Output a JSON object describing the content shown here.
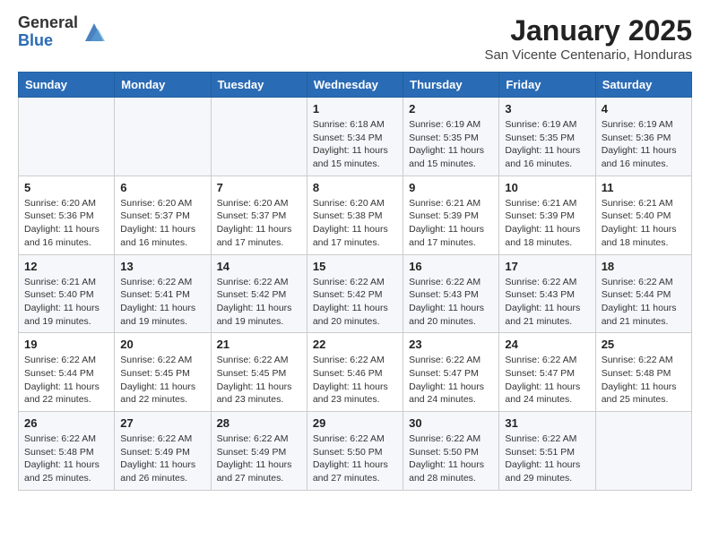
{
  "header": {
    "logo_general": "General",
    "logo_blue": "Blue",
    "month_title": "January 2025",
    "location": "San Vicente Centenario, Honduras"
  },
  "weekdays": [
    "Sunday",
    "Monday",
    "Tuesday",
    "Wednesday",
    "Thursday",
    "Friday",
    "Saturday"
  ],
  "weeks": [
    [
      {
        "day": "",
        "info": ""
      },
      {
        "day": "",
        "info": ""
      },
      {
        "day": "",
        "info": ""
      },
      {
        "day": "1",
        "info": "Sunrise: 6:18 AM\nSunset: 5:34 PM\nDaylight: 11 hours\nand 15 minutes."
      },
      {
        "day": "2",
        "info": "Sunrise: 6:19 AM\nSunset: 5:35 PM\nDaylight: 11 hours\nand 15 minutes."
      },
      {
        "day": "3",
        "info": "Sunrise: 6:19 AM\nSunset: 5:35 PM\nDaylight: 11 hours\nand 16 minutes."
      },
      {
        "day": "4",
        "info": "Sunrise: 6:19 AM\nSunset: 5:36 PM\nDaylight: 11 hours\nand 16 minutes."
      }
    ],
    [
      {
        "day": "5",
        "info": "Sunrise: 6:20 AM\nSunset: 5:36 PM\nDaylight: 11 hours\nand 16 minutes."
      },
      {
        "day": "6",
        "info": "Sunrise: 6:20 AM\nSunset: 5:37 PM\nDaylight: 11 hours\nand 16 minutes."
      },
      {
        "day": "7",
        "info": "Sunrise: 6:20 AM\nSunset: 5:37 PM\nDaylight: 11 hours\nand 17 minutes."
      },
      {
        "day": "8",
        "info": "Sunrise: 6:20 AM\nSunset: 5:38 PM\nDaylight: 11 hours\nand 17 minutes."
      },
      {
        "day": "9",
        "info": "Sunrise: 6:21 AM\nSunset: 5:39 PM\nDaylight: 11 hours\nand 17 minutes."
      },
      {
        "day": "10",
        "info": "Sunrise: 6:21 AM\nSunset: 5:39 PM\nDaylight: 11 hours\nand 18 minutes."
      },
      {
        "day": "11",
        "info": "Sunrise: 6:21 AM\nSunset: 5:40 PM\nDaylight: 11 hours\nand 18 minutes."
      }
    ],
    [
      {
        "day": "12",
        "info": "Sunrise: 6:21 AM\nSunset: 5:40 PM\nDaylight: 11 hours\nand 19 minutes."
      },
      {
        "day": "13",
        "info": "Sunrise: 6:22 AM\nSunset: 5:41 PM\nDaylight: 11 hours\nand 19 minutes."
      },
      {
        "day": "14",
        "info": "Sunrise: 6:22 AM\nSunset: 5:42 PM\nDaylight: 11 hours\nand 19 minutes."
      },
      {
        "day": "15",
        "info": "Sunrise: 6:22 AM\nSunset: 5:42 PM\nDaylight: 11 hours\nand 20 minutes."
      },
      {
        "day": "16",
        "info": "Sunrise: 6:22 AM\nSunset: 5:43 PM\nDaylight: 11 hours\nand 20 minutes."
      },
      {
        "day": "17",
        "info": "Sunrise: 6:22 AM\nSunset: 5:43 PM\nDaylight: 11 hours\nand 21 minutes."
      },
      {
        "day": "18",
        "info": "Sunrise: 6:22 AM\nSunset: 5:44 PM\nDaylight: 11 hours\nand 21 minutes."
      }
    ],
    [
      {
        "day": "19",
        "info": "Sunrise: 6:22 AM\nSunset: 5:44 PM\nDaylight: 11 hours\nand 22 minutes."
      },
      {
        "day": "20",
        "info": "Sunrise: 6:22 AM\nSunset: 5:45 PM\nDaylight: 11 hours\nand 22 minutes."
      },
      {
        "day": "21",
        "info": "Sunrise: 6:22 AM\nSunset: 5:45 PM\nDaylight: 11 hours\nand 23 minutes."
      },
      {
        "day": "22",
        "info": "Sunrise: 6:22 AM\nSunset: 5:46 PM\nDaylight: 11 hours\nand 23 minutes."
      },
      {
        "day": "23",
        "info": "Sunrise: 6:22 AM\nSunset: 5:47 PM\nDaylight: 11 hours\nand 24 minutes."
      },
      {
        "day": "24",
        "info": "Sunrise: 6:22 AM\nSunset: 5:47 PM\nDaylight: 11 hours\nand 24 minutes."
      },
      {
        "day": "25",
        "info": "Sunrise: 6:22 AM\nSunset: 5:48 PM\nDaylight: 11 hours\nand 25 minutes."
      }
    ],
    [
      {
        "day": "26",
        "info": "Sunrise: 6:22 AM\nSunset: 5:48 PM\nDaylight: 11 hours\nand 25 minutes."
      },
      {
        "day": "27",
        "info": "Sunrise: 6:22 AM\nSunset: 5:49 PM\nDaylight: 11 hours\nand 26 minutes."
      },
      {
        "day": "28",
        "info": "Sunrise: 6:22 AM\nSunset: 5:49 PM\nDaylight: 11 hours\nand 27 minutes."
      },
      {
        "day": "29",
        "info": "Sunrise: 6:22 AM\nSunset: 5:50 PM\nDaylight: 11 hours\nand 27 minutes."
      },
      {
        "day": "30",
        "info": "Sunrise: 6:22 AM\nSunset: 5:50 PM\nDaylight: 11 hours\nand 28 minutes."
      },
      {
        "day": "31",
        "info": "Sunrise: 6:22 AM\nSunset: 5:51 PM\nDaylight: 11 hours\nand 29 minutes."
      },
      {
        "day": "",
        "info": ""
      }
    ]
  ]
}
